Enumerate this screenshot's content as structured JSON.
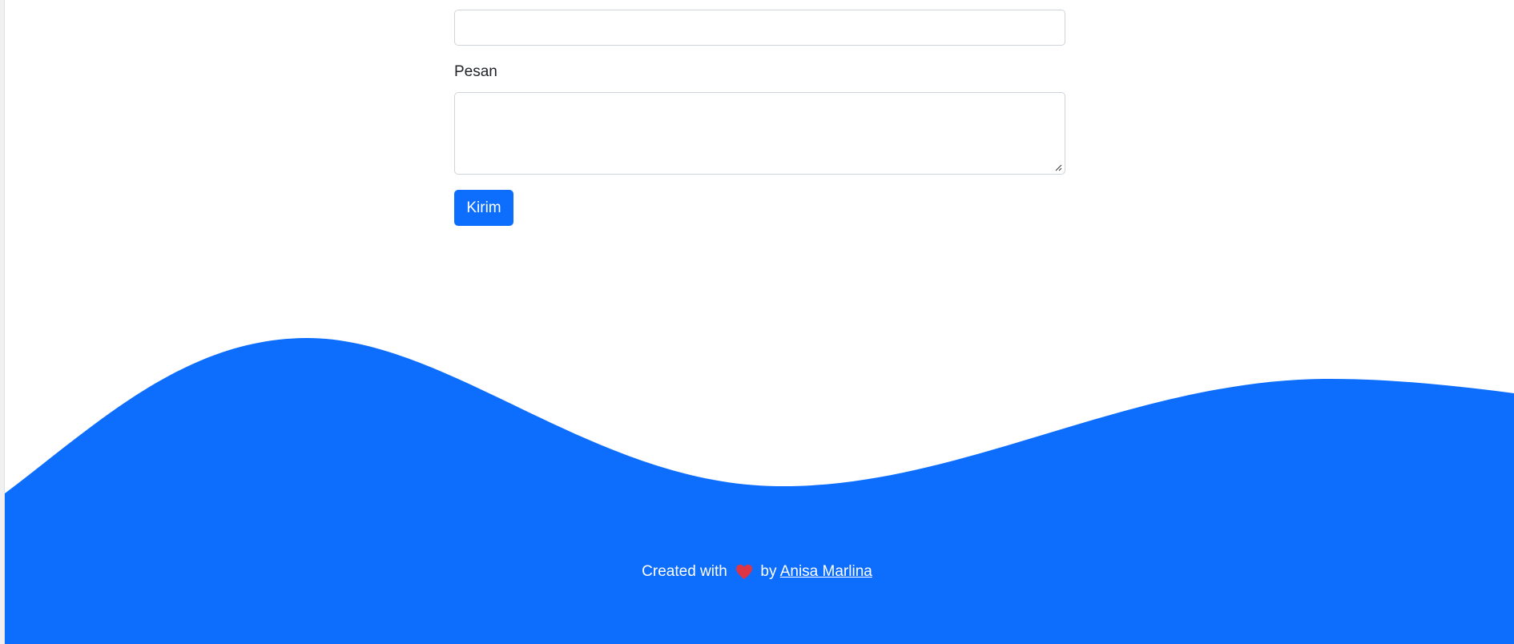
{
  "form": {
    "message_label": "Pesan",
    "submit_label": "Kirim"
  },
  "footer": {
    "created_with": "Created with",
    "heart_icon": "heart-icon",
    "by": "by",
    "author": "Anisa Marlina"
  },
  "colors": {
    "primary": "#0d6efd",
    "heart": "#dc3545",
    "text": "#212529",
    "input_border": "#cfd4da"
  }
}
